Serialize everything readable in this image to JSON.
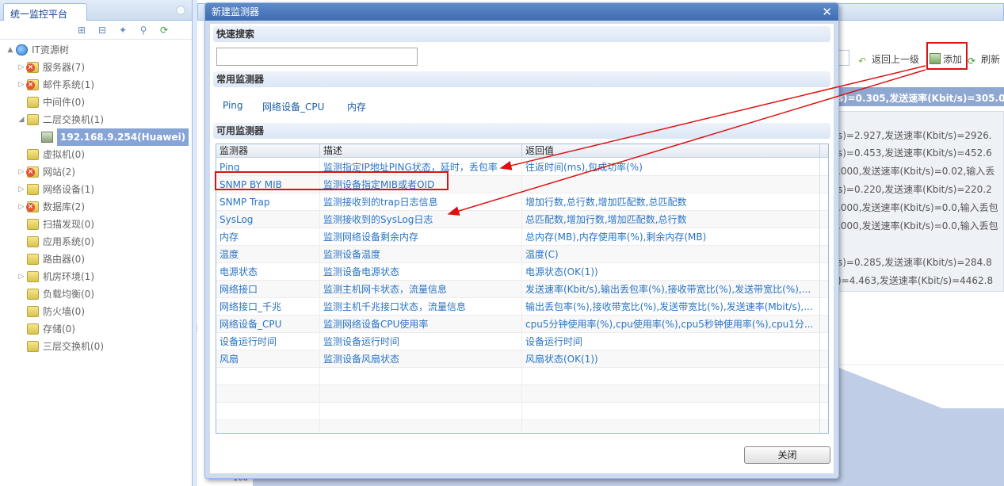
{
  "left_panel": {
    "title": "统一监控平台",
    "toolbar_icons": [
      "expand-all-icon",
      "collapse-all-icon",
      "locate-icon",
      "search-icon",
      "refresh-icon"
    ],
    "tree": [
      {
        "label": "IT资源树",
        "level": 0,
        "icon": "globe",
        "arrow": "▲"
      },
      {
        "label": "服务器(7)",
        "level": 1,
        "icon": "folder-err",
        "arrow": "▷"
      },
      {
        "label": "邮件系统(1)",
        "level": 1,
        "icon": "folder-err",
        "arrow": "▷"
      },
      {
        "label": "中间件(0)",
        "level": 1,
        "icon": "folder",
        "arrow": ""
      },
      {
        "label": "二层交换机(1)",
        "level": 1,
        "icon": "folder",
        "arrow": "◢"
      },
      {
        "label": "192.168.9.254(Huawei)",
        "level": 2,
        "icon": "device",
        "arrow": "",
        "selected": true
      },
      {
        "label": "虚拟机(0)",
        "level": 1,
        "icon": "folder",
        "arrow": ""
      },
      {
        "label": "网站(2)",
        "level": 1,
        "icon": "folder-err",
        "arrow": "▷"
      },
      {
        "label": "网络设备(1)",
        "level": 1,
        "icon": "folder",
        "arrow": "▷"
      },
      {
        "label": "数据库(2)",
        "level": 1,
        "icon": "folder-err",
        "arrow": "▷"
      },
      {
        "label": "扫描发现(0)",
        "level": 1,
        "icon": "folder",
        "arrow": ""
      },
      {
        "label": "应用系统(0)",
        "level": 1,
        "icon": "folder",
        "arrow": ""
      },
      {
        "label": "路由器(0)",
        "level": 1,
        "icon": "folder",
        "arrow": ""
      },
      {
        "label": "机房环境(1)",
        "level": 1,
        "icon": "folder",
        "arrow": "▷"
      },
      {
        "label": "负载均衡(0)",
        "level": 1,
        "icon": "folder",
        "arrow": ""
      },
      {
        "label": "防火墙(0)",
        "level": 1,
        "icon": "folder",
        "arrow": ""
      },
      {
        "label": "存储(0)",
        "level": 1,
        "icon": "folder",
        "arrow": ""
      },
      {
        "label": "三层交换机(0)",
        "level": 1,
        "icon": "folder",
        "arrow": ""
      }
    ]
  },
  "right_panel": {
    "back_label": "返回上一级",
    "add_label": "添加",
    "refresh_label": "刷新",
    "stats": [
      "s)=0.305,发送速率(Kbit/s)=305.0",
      "s)=2.927,发送速率(Kbit/s)=2926.",
      "s)=0.453,发送速率(Kbit/s)=452.6",
      ".000,发送速率(Kbit/s)=0.02,输入丢",
      "s)=0.220,发送速率(Kbit/s)=220.2",
      ".000,发送速率(Kbit/s)=0.0,输入丢包",
      ".000,发送速率(Kbit/s)=0.0,输入丢包",
      "s)=0.285,发送速率(Kbit/s)=284.8",
      ")=4.463,发送速率(Kbit/s)=4462.8"
    ],
    "chart_tick": "100"
  },
  "modal": {
    "title": "新建监测器",
    "quick_search_label": "快速搜索",
    "search_value": "",
    "common_label": "常用监测器",
    "common_items": [
      "Ping",
      "网络设备_CPU",
      "内存"
    ],
    "available_label": "可用监测器",
    "columns": [
      "监测器",
      "描述",
      "返回值"
    ],
    "rows": [
      [
        "Ping",
        "监测指定IP地址PING状态，延时，丢包率",
        "往返时间(ms),包成功率(%)"
      ],
      [
        "SNMP BY MIB",
        "监测设备指定MIB或者OID",
        ""
      ],
      [
        "SNMP Trap",
        "监测接收到的trap日志信息",
        "增加行数,总行数,增加匹配数,总匹配数"
      ],
      [
        "SysLog",
        "监测接收到的SysLog日志",
        "总匹配数,增加行数,增加匹配数,总行数"
      ],
      [
        "内存",
        "监测网络设备剩余内存",
        "总内存(MB),内存使用率(%),剩余内存(MB)"
      ],
      [
        "温度",
        "监测设备温度",
        "温度(C)"
      ],
      [
        "电源状态",
        "监测设备电源状态",
        "电源状态(OK(1))"
      ],
      [
        "网络接口",
        "监测主机网卡状态，流量信息",
        "发送速率(Kbit/s),输出丢包率(%),接收带宽比(%),发送带宽比(%),..."
      ],
      [
        "网络接口_千兆",
        "监测主机千兆接口状态，流量信息",
        "输出丢包率(%),接收带宽比(%),发送带宽比(%),发送速率(Mbit/s),..."
      ],
      [
        "网络设备_CPU",
        "监测网络设备CPU使用率",
        "cpu5分钟使用率(%),cpu使用率(%),cpu5秒钟使用率(%),cpu1分..."
      ],
      [
        "设备运行时间",
        "监测设备运行时间",
        "设备运行时间"
      ],
      [
        "风扇",
        "监测设备风扇状态",
        "风扇状态(OK(1))"
      ]
    ],
    "empty_rows": 4,
    "close_label": "关闭"
  },
  "colors": {
    "link": "#2a74c4",
    "highlight": "#dd1111",
    "title_bar": "#4a78bd"
  }
}
